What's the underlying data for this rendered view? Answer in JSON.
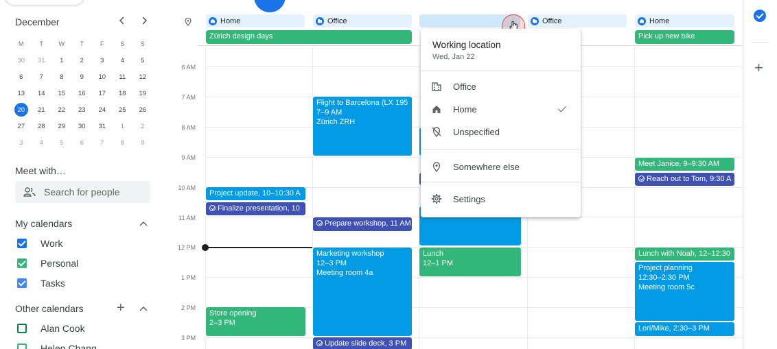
{
  "colors": {
    "accent": "#1a73e8",
    "event_blue": "#039be5",
    "event_green": "#33b679",
    "task_indigo": "#3f51b5",
    "work": "#1a73e8",
    "personal": "#33b679",
    "tasks": "#4285f4",
    "alan_cook": "#0b8043",
    "helen_chang": "#33b679"
  },
  "mini_calendar": {
    "title": "December",
    "prev_icon": "chevron-left-icon",
    "next_icon": "chevron-right-icon",
    "weekdays": [
      "M",
      "T",
      "W",
      "T",
      "F",
      "S",
      "S"
    ],
    "weeks": [
      [
        "30",
        "31",
        "1",
        "2",
        "3",
        "4",
        "5"
      ],
      [
        "6",
        "7",
        "8",
        "9",
        "10",
        "11",
        "12"
      ],
      [
        "13",
        "14",
        "15",
        "16",
        "17",
        "18",
        "19"
      ],
      [
        "20",
        "21",
        "22",
        "23",
        "24",
        "25",
        "26"
      ],
      [
        "27",
        "28",
        "29",
        "30",
        "31",
        "1",
        "2"
      ],
      [
        "3",
        "4",
        "5",
        "6",
        "7",
        "8",
        "9"
      ]
    ],
    "today": "20"
  },
  "meet_with": {
    "title": "Meet with…",
    "search_placeholder": "Search for people",
    "icon": "people-icon"
  },
  "my_calendars": {
    "title": "My calendars",
    "items": [
      {
        "label": "Work",
        "checked": true
      },
      {
        "label": "Personal",
        "checked": true
      },
      {
        "label": "Tasks",
        "checked": true
      }
    ]
  },
  "other_calendars": {
    "title": "Other calendars",
    "items": [
      {
        "label": "Alan Cook",
        "checked": false
      },
      {
        "label": "Helen Chang",
        "checked": false
      }
    ]
  },
  "header": {
    "location_icon": "location-pin-icon",
    "chips": [
      {
        "label": "Home",
        "icon": "home-icon"
      },
      {
        "label": "Office",
        "icon": "office-icon"
      },
      {
        "label": "",
        "icon": ""
      },
      {
        "label": "Office",
        "icon": "office-icon"
      },
      {
        "label": "Home",
        "icon": "home-icon"
      }
    ],
    "all_day": [
      {
        "label": "Zürich design days"
      },
      {
        "label": "Pick up new bike"
      }
    ]
  },
  "time_labels": [
    "6 AM",
    "7 AM",
    "8 AM",
    "9 AM",
    "10 AM",
    "11 AM",
    "12 PM",
    "1 PM",
    "2 PM",
    "3 PM"
  ],
  "events": {
    "project_update": "Project update, 10–10:30 A",
    "finalize_presentation": "Finalize presentation, 10",
    "store_opening_title": "Store opening",
    "store_opening_time": "2–3 PM",
    "flight_title": "Flight to Barcelona (LX 195",
    "flight_time": "7–9 AM",
    "flight_place": "Zürich ZRH",
    "prepare_workshop": "Prepare workshop, 11 AM",
    "marketing_title": "Marketing workshop",
    "marketing_time": "12–3 PM",
    "marketing_place": "Meeting room 4a",
    "update_slide_deck": "Update slide deck, 3 PM",
    "lunch_title": "Lunch",
    "lunch_time": "12–1 PM",
    "meet_janice": "Meet Janice, 9–9:30 AM",
    "reach_out_tom": "Reach out to Tom, 9:30 A",
    "lunch_noah": "Lunch with Noah, 12–12:30",
    "project_planning_title": "Project planning",
    "project_planning_time": "12:30–2:30 PM",
    "project_planning_place": "Meeting room 5c",
    "lori_mike": "Lori/Mike, 2:30–3 PM"
  },
  "working_location_menu": {
    "title": "Working location",
    "date": "Wed, Jan 22",
    "items": [
      {
        "label": "Office",
        "icon": "office-building-icon",
        "selected": false
      },
      {
        "label": "Home",
        "icon": "home-icon",
        "selected": true
      },
      {
        "label": "Unspecified",
        "icon": "location-off-icon",
        "selected": false
      },
      {
        "label": "Somewhere else",
        "icon": "location-pin-icon",
        "selected": false
      },
      {
        "label": "Settings",
        "icon": "gear-icon",
        "selected": false
      }
    ]
  },
  "right_rail": {
    "tasks_icon": "tasks-icon",
    "add_icon": "plus-icon"
  }
}
